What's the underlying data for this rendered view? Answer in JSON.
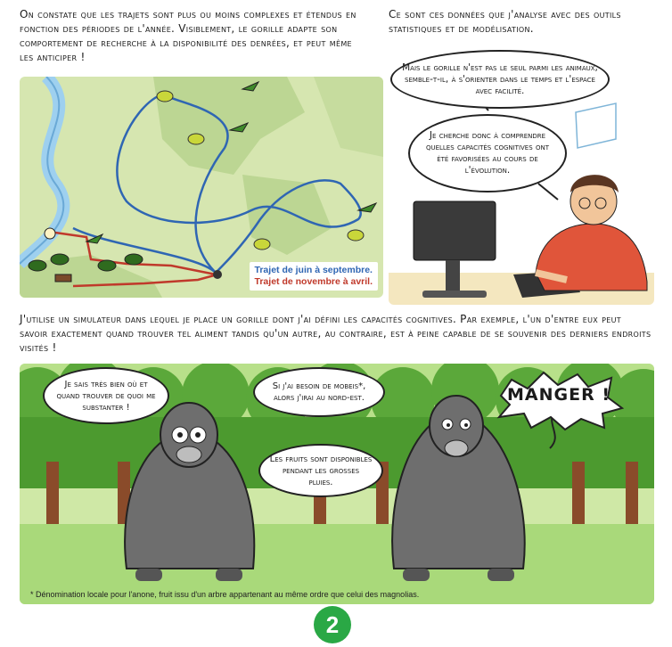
{
  "captions": {
    "top_left": "On constate que les trajets sont plus ou moins complexes et étendus en fonction des périodes de l'année. Visiblement, le gorille adapte son comportement de recherche à la disponibilité des denrées, et peut même les anticiper !",
    "top_right": "Ce sont ces données que j'analyse avec des outils statistiques et de modélisation.",
    "middle": "J'utilise un simulateur dans lequel je place un gorille dont j'ai défini les capacités cognitives. Par exemple, l'un d'entre eux peut savoir exactement quand trouver tel aliment tandis qu'un autre, au contraire, est à peine capable de se souvenir des derniers endroits visités !"
  },
  "map": {
    "legend_blue": "Trajet de juin à septembre.",
    "legend_red": "Trajet de novembre à avril."
  },
  "office": {
    "bubble_1": "Mais le gorille n'est pas le seul parmi les animaux, semble-t-il, à s'orienter dans le temps et l'espace avec facilité.",
    "bubble_2": "Je cherche donc à comprendre quelles capacités cognitives ont été favorisées au cours de l'évolution."
  },
  "forest": {
    "bubble_knows": "Je sais très bien où et quand trouver de quoi me substanter !",
    "bubble_mobeis": "Si j'ai besoin de mobeis*, alors j'irai au nord-est.",
    "bubble_fruits": "Les fruits sont disponibles pendant les grosses pluies.",
    "shout": "MANGER !",
    "footnote": "* Dénomination locale pour l'anone, fruit issu d'un arbre appartenant au même ordre que celui des magnolias."
  },
  "page_number": "2",
  "colors": {
    "blue_path": "#2f66b3",
    "red_path": "#c0392b",
    "page_badge": "#2aa845"
  }
}
